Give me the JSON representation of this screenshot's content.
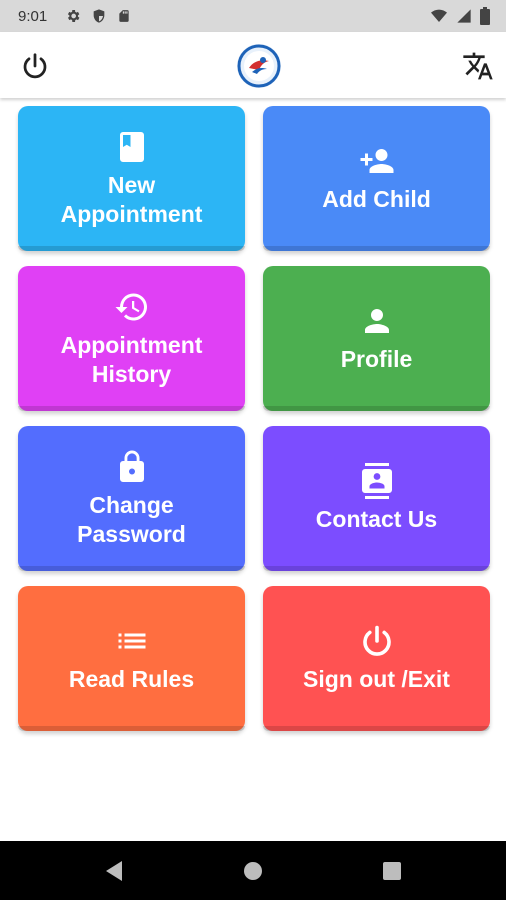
{
  "status_bar": {
    "time": "9:01",
    "icons": [
      "settings-icon",
      "shield-icon",
      "sd-card-icon",
      "wifi-icon",
      "cell-signal-icon",
      "battery-icon"
    ]
  },
  "app_bar": {
    "left_icon": "power-icon",
    "center_icon": "logo",
    "right_icon": "translate-icon"
  },
  "menu": {
    "tiles": [
      {
        "label": "New\nAppointment",
        "icon": "book-icon",
        "color": "#2cb5f5"
      },
      {
        "label": "Add Child",
        "icon": "person-add-icon",
        "color": "#4a8af7"
      },
      {
        "label": "Appointment\nHistory",
        "icon": "history-icon",
        "color": "#e040f5"
      },
      {
        "label": "Profile",
        "icon": "person-icon",
        "color": "#4caf50"
      },
      {
        "label": "Change\nPassword",
        "icon": "lock-icon",
        "color": "#536dfe"
      },
      {
        "label": "Contact Us",
        "icon": "contact-icon",
        "color": "#7c4dff"
      },
      {
        "label": "Read Rules",
        "icon": "list-icon",
        "color": "#ff6e40"
      },
      {
        "label": "Sign out /Exit",
        "icon": "power-icon",
        "color": "#ff5252"
      }
    ]
  },
  "nav_bar": {
    "icons": [
      "back-icon",
      "home-icon",
      "recents-icon"
    ]
  }
}
